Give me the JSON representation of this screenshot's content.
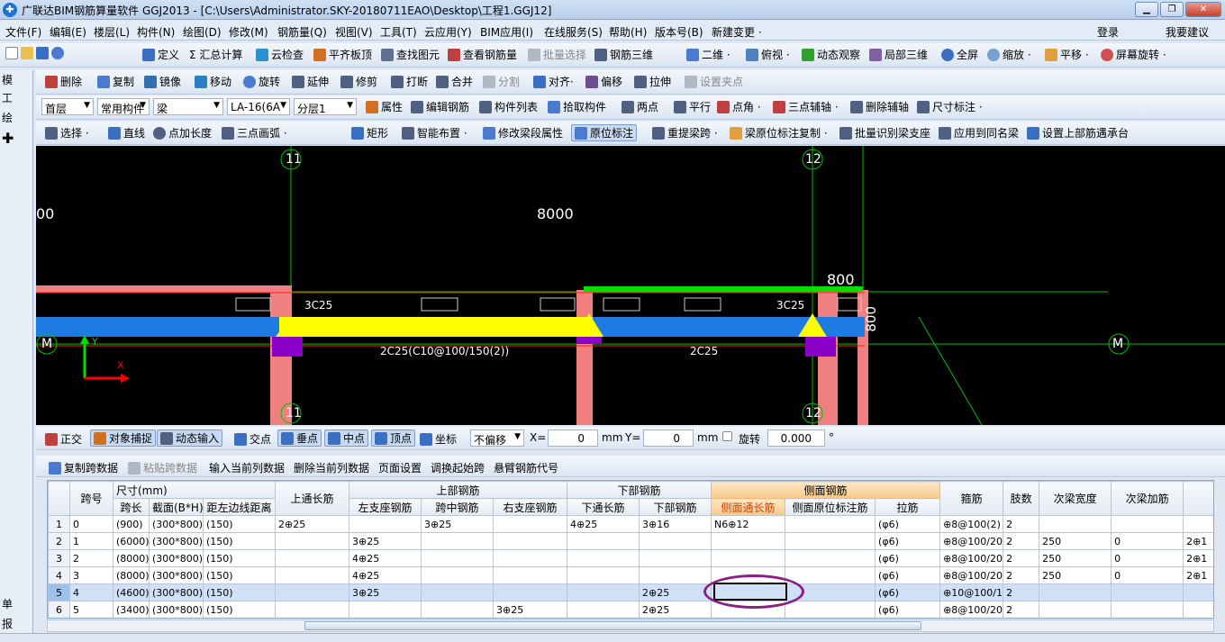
{
  "window": {
    "title": "广联达BIM钢筋算量软件 GGJ2013 - [C:\\Users\\Administrator.SKY-20180711EAO\\Desktop\\工程1.GGJ12]",
    "app_icon": "✚",
    "minimize": "▁",
    "maximize": "❐",
    "close": "✕"
  },
  "menu": [
    "文件(F)",
    "编辑(E)",
    "楼层(L)",
    "构件(N)",
    "绘图(D)",
    "修改(M)",
    "钢筋量(Q)",
    "视图(V)",
    "工具(T)",
    "云应用(Y)",
    "BIM应用(I)",
    "在线服务(S)",
    "帮助(H)",
    "版本号(B)",
    "新建变更 ·"
  ],
  "menu_right": {
    "login": "登录",
    "suggest": "我要建议"
  },
  "toolbar1": [
    "定义",
    "Σ 汇总计算",
    "云检查",
    "平齐板顶",
    "查找图元",
    "查看钢筋量",
    "批量选择",
    "钢筋三维",
    "二维 ·",
    "俯视 ·",
    "动态观察",
    "局部三维",
    "全屏",
    "缩放 ·",
    "平移 ·",
    "屏幕旋转 ·"
  ],
  "toolbar2": [
    "删除",
    "复制",
    "镜像",
    "移动",
    "旋转",
    "延伸",
    "修剪",
    "打断",
    "合并",
    "分割",
    "对齐·",
    "偏移",
    "拉伸",
    "设置夹点"
  ],
  "toolbar3": {
    "floor": "首层",
    "category": "常用构件",
    "type": "梁",
    "component": "LA-16(6A",
    "layer": "分层1",
    "buttons": [
      "属性",
      "编辑钢筋",
      "构件列表",
      "拾取构件",
      "两点",
      "平行",
      "点角 ·",
      "三点辅轴 ·",
      "删除辅轴",
      "尺寸标注 ·"
    ]
  },
  "toolbar4": [
    "选择 ·",
    "直线",
    "点加长度",
    "三点画弧 ·",
    "矩形",
    "智能布置 ·",
    "修改梁段属性",
    "原位标注",
    "重提梁跨 ·",
    "梁原位标注复制 ·",
    "批量识别梁支座",
    "应用到同名梁",
    "设置上部筋遇承台"
  ],
  "left_panel": [
    "模",
    "工",
    "绘",
    "✚",
    "单",
    "报"
  ],
  "canvas": {
    "axis_11": "11",
    "axis_12": "12",
    "axis_m": "M",
    "dim_left": "00",
    "dim_8000": "8000",
    "dim_800": "800",
    "dim_800v": "800",
    "label_3c25_left": "3C25",
    "label_3c25_right": "3C25",
    "label_2c25_main": "2C25(C10@100/150(2))",
    "label_2c25_right": "2C25",
    "axis_x": "X",
    "axis_y": "Y",
    "colors": {
      "beam": "#1e7be6",
      "highlight": "#ffff00",
      "column": "#f08080",
      "grid": "#00c000",
      "support": "#8b00c8"
    }
  },
  "snapbar": {
    "ortho": "正交",
    "osnap": "对象捕捉",
    "dyninput": "动态输入",
    "intersect": "交点",
    "perp": "垂点",
    "mid": "中点",
    "vertex": "顶点",
    "coord": "坐标",
    "offset": "不偏移",
    "x_label": "X=",
    "x_value": "0",
    "mm1": "mm",
    "y_label": "Y=",
    "y_value": "0",
    "mm2": "mm",
    "rotate": "旋转",
    "rotate_value": "0.000",
    "deg": "°"
  },
  "grid_toolbar": [
    "复制跨数据",
    "粘贴跨数据",
    "输入当前列数据",
    "删除当前列数据",
    "页面设置",
    "调换起始跨",
    "悬臂钢筋代号"
  ],
  "grid": {
    "group_headers": {
      "size": "尺寸(mm)",
      "top": "上部钢筋",
      "bottom": "下部钢筋",
      "side": "侧面钢筋"
    },
    "col_span_no": "跨号",
    "col_top_through": "上通长筋",
    "sub_headers": [
      "跨长",
      "截面(B*H)",
      "距左边线距离",
      "左支座钢筋",
      "跨中钢筋",
      "右支座钢筋",
      "下通长筋",
      "下部钢筋",
      "侧面通长筋",
      "侧面原位标注筋",
      "拉筋"
    ],
    "col_stirrup": "箍筋",
    "col_legs": "肢数",
    "col_sec_width": "次梁宽度",
    "col_sec_add": "次梁加筋",
    "rows": [
      [
        "1",
        "0",
        "(900)",
        "(300*800)",
        "(150)",
        "2⊕25",
        "",
        "3⊕25",
        "",
        "4⊕25",
        "3⊕16",
        "N6⊕12",
        "",
        "(φ6)",
        "⊕8@100(2)",
        "2",
        "",
        "",
        ""
      ],
      [
        "2",
        "1",
        "(6000)",
        "(300*800)",
        "(150)",
        "",
        "3⊕25",
        "",
        "",
        "",
        "",
        "",
        "",
        "(φ6)",
        "⊕8@100/20",
        "2",
        "250",
        "0",
        "2⊕1"
      ],
      [
        "3",
        "2",
        "(8000)",
        "(300*800)",
        "(150)",
        "",
        "4⊕25",
        "",
        "",
        "",
        "",
        "",
        "",
        "(φ6)",
        "⊕8@100/20",
        "2",
        "250",
        "0",
        "2⊕1"
      ],
      [
        "4",
        "3",
        "(8000)",
        "(300*800)",
        "(150)",
        "",
        "4⊕25",
        "",
        "",
        "",
        "",
        "",
        "",
        "(φ6)",
        "⊕8@100/20",
        "2",
        "250",
        "0",
        "2⊕1"
      ],
      [
        "5",
        "4",
        "(4600)",
        "(300*800)",
        "(150)",
        "",
        "3⊕25",
        "",
        "",
        "",
        "2⊕25",
        "",
        "",
        "(φ6)",
        "⊕10@100/1",
        "2",
        "",
        "",
        ""
      ],
      [
        "6",
        "5",
        "(3400)",
        "(300*800)",
        "(150)",
        "",
        "",
        "",
        "3⊕25",
        "",
        "2⊕25",
        "",
        "",
        "(φ6)",
        "⊕8@100/20",
        "2",
        "",
        "",
        ""
      ]
    ]
  }
}
